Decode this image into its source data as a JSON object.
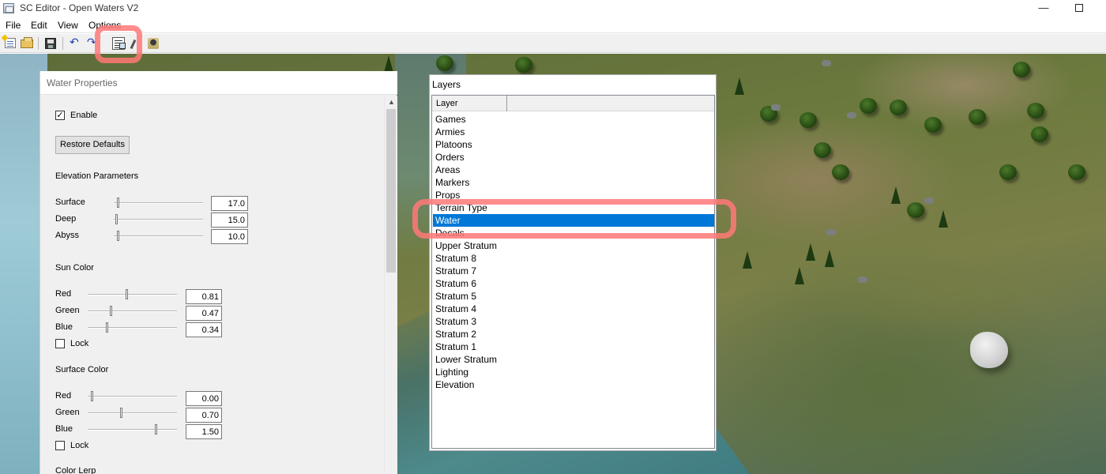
{
  "window": {
    "title": "SC Editor - Open Waters V2",
    "icon": "app-icon",
    "minimize": "—"
  },
  "menu": {
    "items": [
      "File",
      "Edit",
      "View",
      "Options"
    ]
  },
  "toolbar": {
    "buttons": [
      "new-icon",
      "open-icon",
      "save-icon",
      "undo-icon",
      "redo-icon",
      "properties-icon",
      "brush-icon",
      "tree-icon"
    ],
    "undo_glyph": "↶",
    "redo_glyph": "↷"
  },
  "water_panel": {
    "title": "Water Properties",
    "enable_label": "Enable",
    "enable_checked": true,
    "check_glyph": "✓",
    "restore_label": "Restore Defaults",
    "elevation_heading": "Elevation Parameters",
    "elevation": [
      {
        "label": "Surface",
        "value": "17.0",
        "fraction": 0.04
      },
      {
        "label": "Deep",
        "value": "15.0",
        "fraction": 0.03
      },
      {
        "label": "Abyss",
        "value": "10.0",
        "fraction": 0.04
      }
    ],
    "sun_heading": "Sun Color",
    "sun": [
      {
        "label": "Red",
        "value": "0.81",
        "fraction": 0.43
      },
      {
        "label": "Green",
        "value": "0.47",
        "fraction": 0.26
      },
      {
        "label": "Blue",
        "value": "0.34",
        "fraction": 0.21
      }
    ],
    "sun_lock": "Lock",
    "surface_heading": "Surface Color",
    "surface": [
      {
        "label": "Red",
        "value": "0.00",
        "fraction": 0.04
      },
      {
        "label": "Green",
        "value": "0.70",
        "fraction": 0.37
      },
      {
        "label": "Blue",
        "value": "1.50",
        "fraction": 0.76
      }
    ],
    "surface_lock": "Lock",
    "next_heading": "Color Lerp",
    "scroll_up": "▲"
  },
  "layers_panel": {
    "title": "Layers",
    "column": "Layer",
    "items": [
      "Games",
      "Armies",
      "Platoons",
      "Orders",
      "Areas",
      "Markers",
      "Props",
      "Terrain Type",
      "Water",
      "Decals",
      "Upper Stratum",
      "Stratum 8",
      "Stratum 7",
      "Stratum 6",
      "Stratum 5",
      "Stratum 4",
      "Stratum 3",
      "Stratum 2",
      "Stratum 1",
      "Lower Stratum",
      "Lighting",
      "Elevation"
    ],
    "selected": "Water"
  },
  "colors": {
    "selection": "#0078d7",
    "highlight": "#ff7878"
  }
}
